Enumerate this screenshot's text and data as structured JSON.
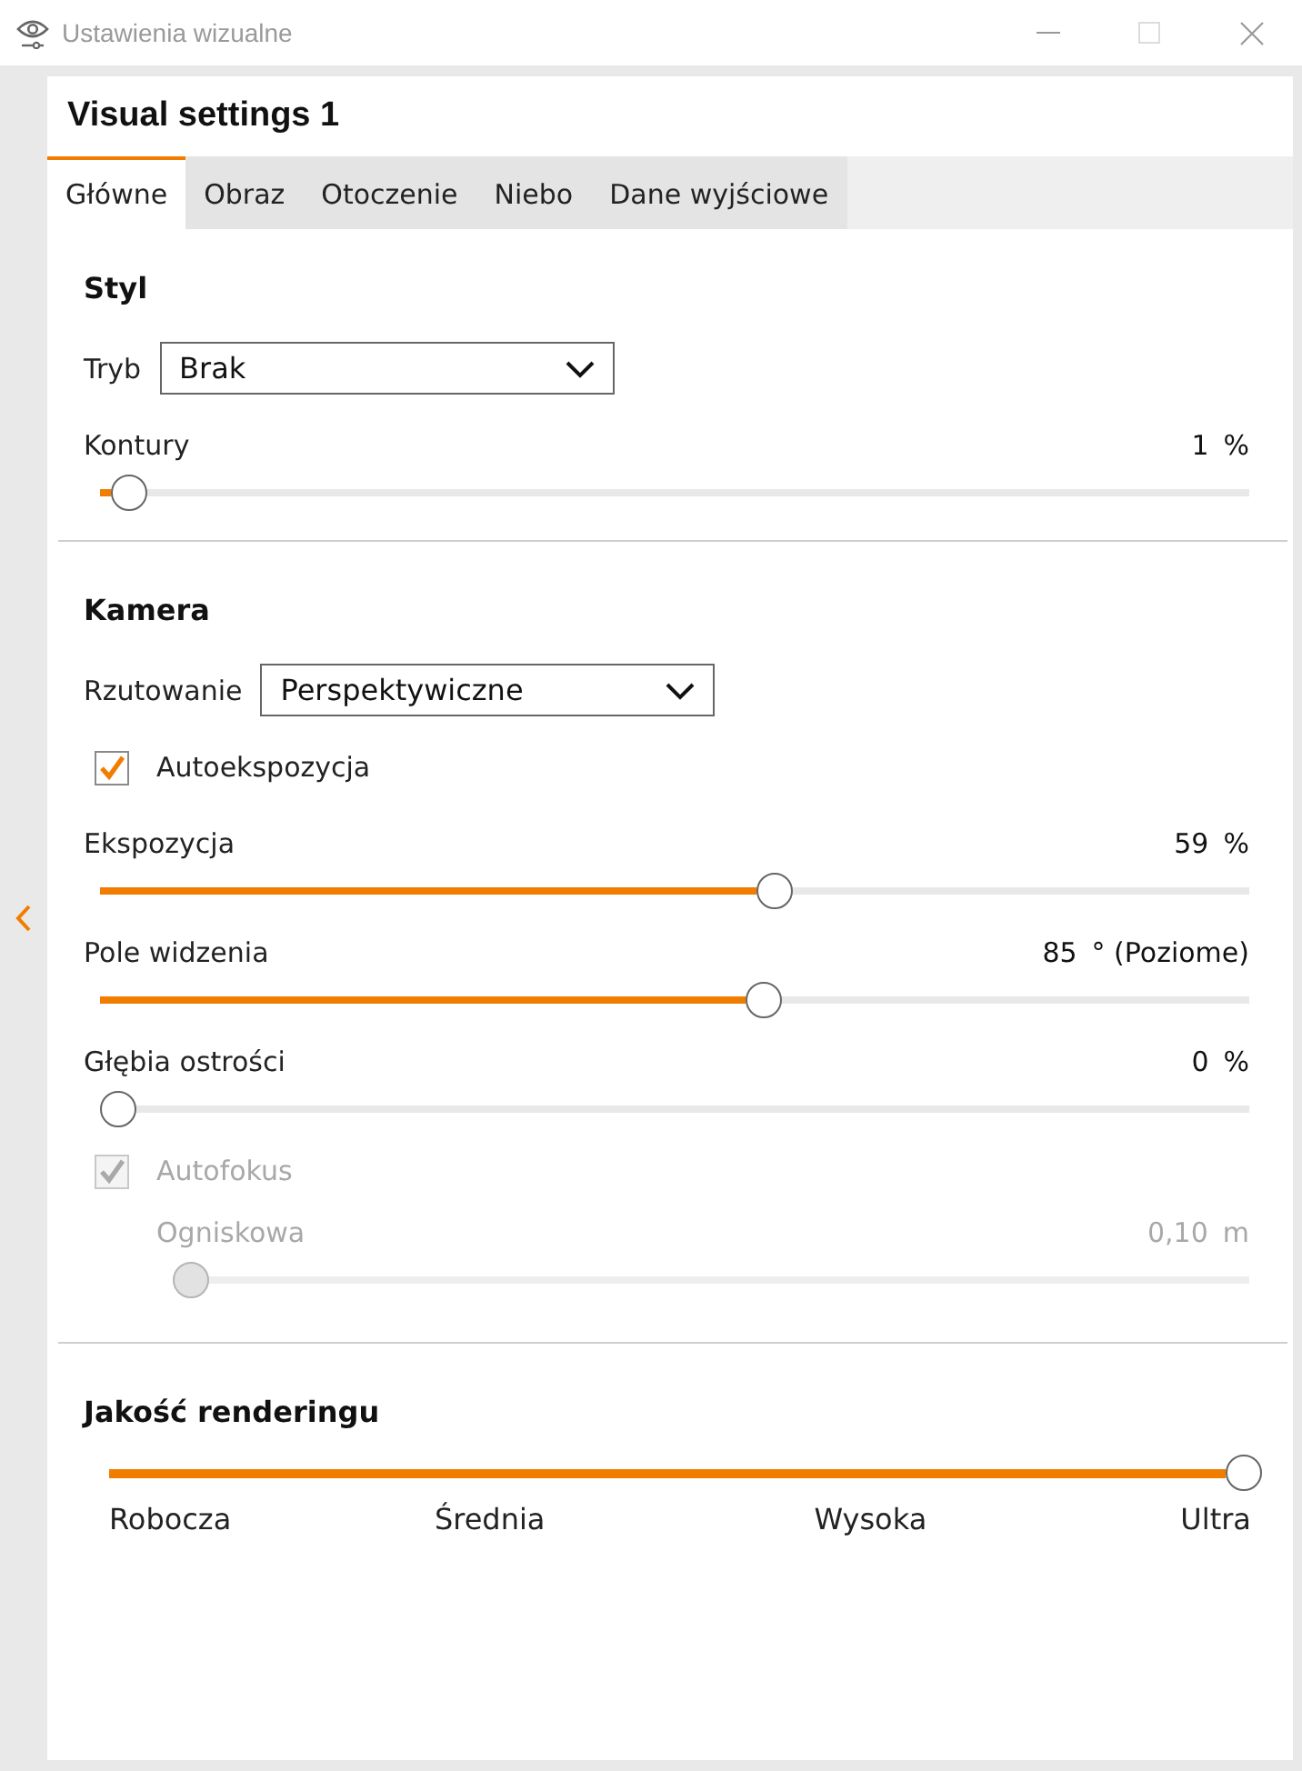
{
  "window": {
    "title": "Ustawienia wizualne",
    "controls": [
      {
        "kind": "minimize",
        "disabled": false
      },
      {
        "kind": "maximize",
        "disabled": true
      },
      {
        "kind": "close",
        "disabled": false
      }
    ]
  },
  "panel": {
    "title": "Visual settings 1"
  },
  "tabs": [
    {
      "label": "Główne",
      "selected": true
    },
    {
      "label": "Obraz",
      "selected": false
    },
    {
      "label": "Otoczenie",
      "selected": false
    },
    {
      "label": "Niebo",
      "selected": false
    },
    {
      "label": "Dane wyjściowe",
      "selected": false
    }
  ],
  "sections": [
    {
      "title": "Styl",
      "items": [
        {
          "kind": "select",
          "label": "Tryb",
          "value": "Brak"
        },
        {
          "kind": "slider",
          "label": "Kontury",
          "value": "1",
          "unit": "%",
          "level": 0.01,
          "disabled": false
        }
      ]
    },
    {
      "title": "Kamera",
      "items": [
        {
          "kind": "select",
          "label": "Rzutowanie",
          "value": "Perspektywiczne"
        },
        {
          "kind": "checkbox",
          "label": "Autoekspozycja",
          "checked": true,
          "disabled": false
        },
        {
          "kind": "slider",
          "label": "Ekspozycja",
          "value": "59",
          "unit": "%",
          "level": 0.59,
          "disabled": false
        },
        {
          "kind": "slider",
          "label": "Pole widzenia",
          "value": "85",
          "unit": "° (Poziome)",
          "level": 0.58,
          "disabled": false
        },
        {
          "kind": "slider",
          "label": "Głębia ostrości",
          "value": "0",
          "unit": "%",
          "level": 0,
          "disabled": false
        },
        {
          "kind": "checkbox",
          "label": "Autofokus",
          "checked": true,
          "disabled": true,
          "children": [
            {
              "kind": "slider",
              "label": "Ogniskowa",
              "value": "0,10",
              "unit": "m",
              "level": 0,
              "disabled": true
            }
          ]
        }
      ]
    },
    {
      "title": "Jakość renderingu",
      "items": [
        {
          "kind": "steps",
          "level": 1,
          "stops": [
            "Robocza",
            "Średnia",
            "Wysoka",
            "Ultra"
          ]
        }
      ]
    }
  ]
}
